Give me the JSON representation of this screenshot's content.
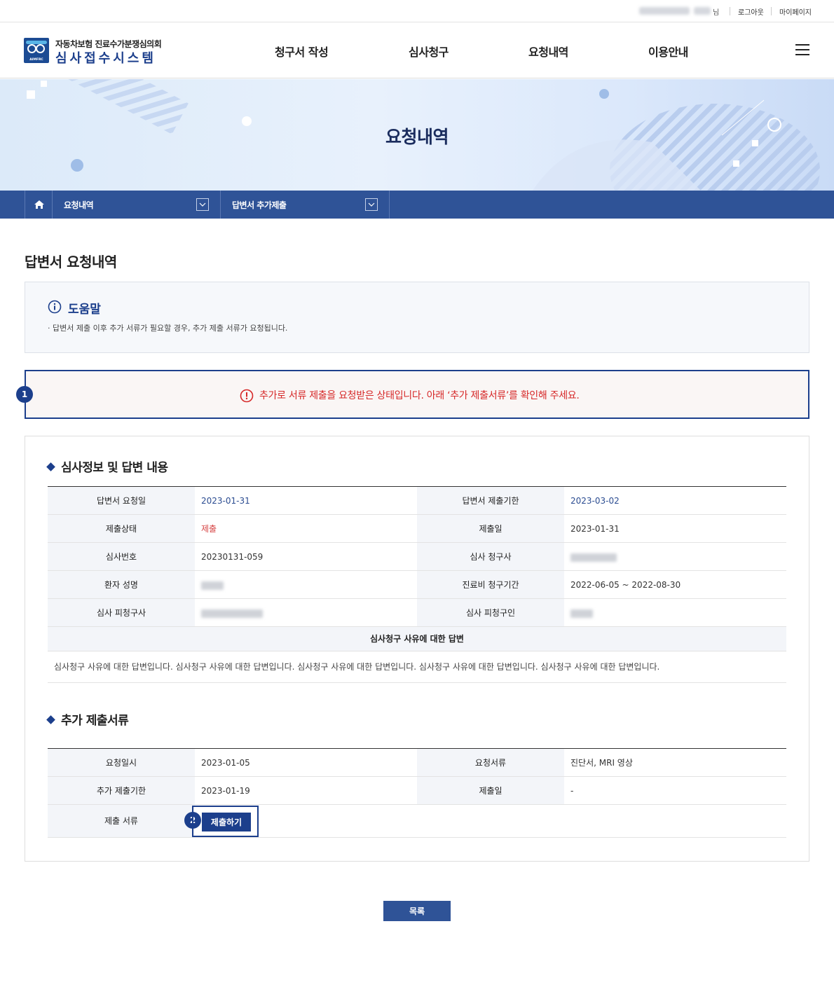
{
  "util": {
    "user_suffix": "님",
    "logout": "로그아웃",
    "mypage": "마이페이지"
  },
  "header": {
    "logo_top": "자동차보험 진료수가분쟁심의회",
    "logo_main": "심사접수시스템",
    "logo_abbr": "AIMFRC",
    "nav": [
      "청구서 작성",
      "심사청구",
      "요청내역",
      "이용안내"
    ]
  },
  "visual": {
    "title": "요청내역"
  },
  "location": {
    "depth1": "요청내역",
    "depth2": "답변서 추가제출"
  },
  "page_title": "답변서 요청내역",
  "help": {
    "title": "도움말",
    "text": "· 답변서 제출 이후 추가 서류가 필요할 경우, 추가 제출 서류가 요청됩니다."
  },
  "alert": {
    "step": "1",
    "text": "추가로 서류 제출을 요청받은 상태입니다. 아래 ‘추가 제출서류’를 확인해 주세요."
  },
  "review": {
    "title": "심사정보 및 답변 내용",
    "labels": {
      "request_date": "답변서 요청일",
      "deadline": "답변서 제출기한",
      "status": "제출상태",
      "submit_date": "제출일",
      "review_no": "심사번호",
      "claimant": "심사 청구사",
      "patient": "환자 성명",
      "period": "진료비 청구기간",
      "respondent": "심사 피청구사",
      "respondent_person": "심사 피청구인",
      "answer_header": "심사청구 사유에 대한 답변"
    },
    "values": {
      "request_date": "2023-01-31",
      "deadline": "2023-03-02",
      "status": "제출",
      "submit_date": "2023-01-31",
      "review_no": "20230131-059",
      "period": "2022-06-05 ~ 2022-08-30"
    },
    "answer": "심사청구 사유에 대한 답변입니다. 심사청구 사유에 대한 답변입니다. 심사청구 사유에 대한 답변입니다. 심사청구 사유에 대한 답변입니다. 심사청구 사유에 대한 답변입니다."
  },
  "additional": {
    "title": "추가 제출서류",
    "labels": {
      "request_datetime": "요청일시",
      "request_docs": "요청서류",
      "add_deadline": "추가 제출기한",
      "submit_date": "제출일",
      "submit_docs": "제출 서류"
    },
    "values": {
      "request_datetime": "2023-01-05",
      "request_docs": "진단서, MRI 영상",
      "add_deadline": "2023-01-19",
      "submit_date": "-"
    },
    "step": "2",
    "submit_button": "제출하기"
  },
  "list_button": "목록",
  "colors": {
    "primary": "#1c3f8c",
    "location_bar": "#2f5397",
    "alert_text": "#d62828",
    "status_red": "#d64545"
  }
}
